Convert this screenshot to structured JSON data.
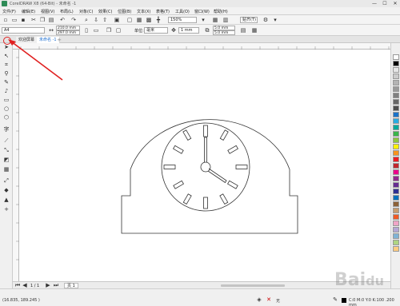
{
  "window": {
    "title": "CorelDRAW X8 (64-Bit) - 未命名 -1",
    "minimize": "—",
    "maximize": "☐",
    "close": "✕"
  },
  "menu": {
    "items": [
      "文件(F)",
      "编辑(E)",
      "视图(V)",
      "布局(L)",
      "对象(C)",
      "效果(C)",
      "位图(B)",
      "文本(X)",
      "表格(T)",
      "工具(O)",
      "窗口(W)",
      "帮助(H)"
    ]
  },
  "toolbar": {
    "zoom": "150%",
    "snap": "贴齐(T)"
  },
  "propbar": {
    "page_size": "A4",
    "width": "210.0 mm",
    "height": "297.0 mm",
    "units_label": "单位:",
    "units": "毫米",
    "nudge": "1 mm",
    "dup_x": "5.0 mm",
    "dup_y": "5.0 mm"
  },
  "tabs": {
    "welcome": "欢迎屏幕",
    "doc": "未命名 -1"
  },
  "pagebar": {
    "nav": "1 / 1",
    "page": "页 1"
  },
  "status": {
    "coords": "(16.835, 189.245 )",
    "fill_label": "无",
    "outline": "C:0 M:0 Y:0 K:100 .200 mm"
  },
  "colors": {
    "accent": "#1e6fd0",
    "annotation_red": "#e02020",
    "canvas": "#ffffff",
    "clock_stroke": "#333333"
  },
  "palette": [
    "#ffffff",
    "#000000",
    "#e6e6e6",
    "#cccccc",
    "#b3b3b3",
    "#999999",
    "#808080",
    "#666666",
    "#4d4d4d",
    "#1a73c9",
    "#29abe2",
    "#00a99d",
    "#39b54a",
    "#8dc63f",
    "#fff200",
    "#f7941d",
    "#ed1c24",
    "#c1272d",
    "#ec008c",
    "#92278f",
    "#662d91",
    "#2e3192",
    "#0071bc",
    "#8c6239",
    "#c69c6d",
    "#f15a24",
    "#f0a5c6",
    "#b4a7d6",
    "#7fb3d5",
    "#aed581",
    "#ffcc80"
  ]
}
